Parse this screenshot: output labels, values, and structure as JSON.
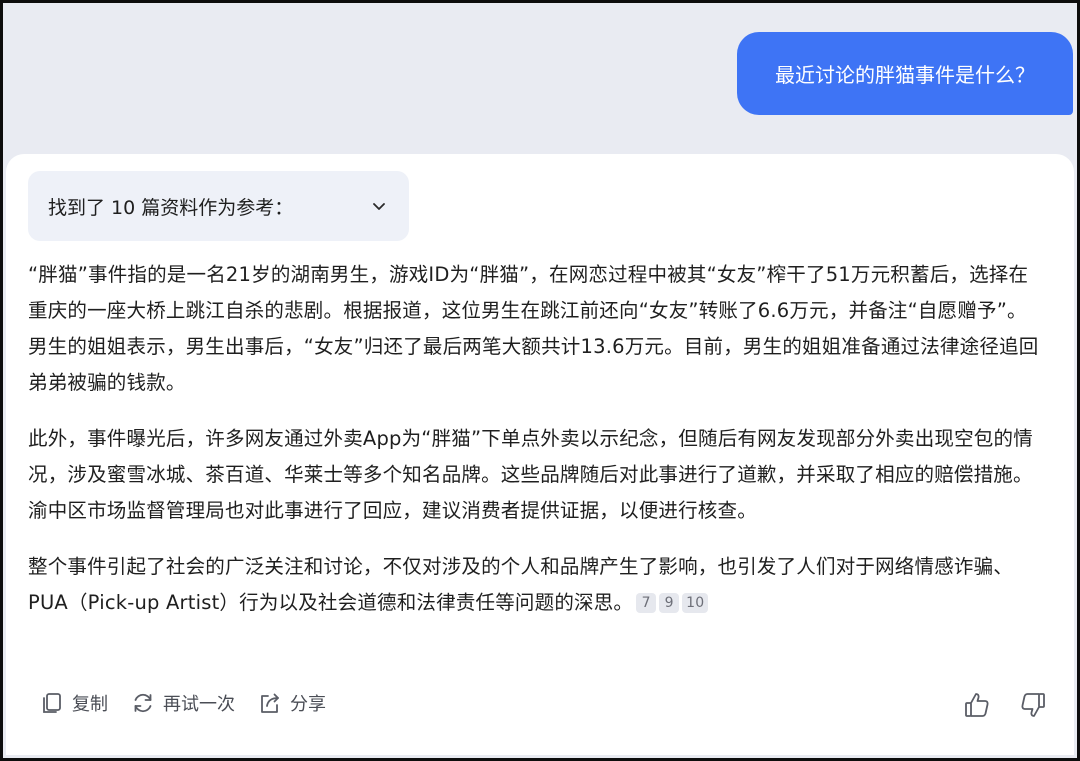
{
  "user_message": {
    "text": "最近讨论的胖猫事件是什么？"
  },
  "sources": {
    "label": "找到了 10 篇资料作为参考：",
    "icon": "chevron-down-icon"
  },
  "answer": {
    "paragraphs": [
      "“胖猫”事件指的是一名21岁的湖南男生，游戏ID为“胖猫”，在网恋过程中被其“女友”榨干了51万元积蓄后，选择在重庆的一座大桥上跳江自杀的悲剧。根据报道，这位男生在跳江前还向“女友”转账了6.6万元，并备注“自愿赠予”。男生的姐姐表示，男生出事后，“女友”归还了最后两笔大额共计13.6万元。目前，男生的姐姐准备通过法律途径追回弟弟被骗的钱款。",
      "此外，事件曝光后，许多网友通过外卖App为“胖猫”下单点外卖以示纪念，但随后有网友发现部分外卖出现空包的情况，涉及蜜雪冰城、茶百道、华莱士等多个知名品牌。这些品牌随后对此事进行了道歉，并采取了相应的赔偿措施。渝中区市场监督管理局也对此事进行了回应，建议消费者提供证据，以便进行核查。",
      "整个事件引起了社会的广泛关注和讨论，不仅对涉及的个人和品牌产生了影响，也引发了人们对于网络情感诈骗、PUA（Pick-up Artist）行为以及社会道德和法律责任等问题的深思。"
    ],
    "citations": [
      "7",
      "9",
      "10"
    ]
  },
  "actions": {
    "copy": "复制",
    "retry": "再试一次",
    "share": "分享"
  },
  "colors": {
    "user_bubble": "#3e74f5",
    "background": "#e9ebf2",
    "card": "#ffffff"
  }
}
